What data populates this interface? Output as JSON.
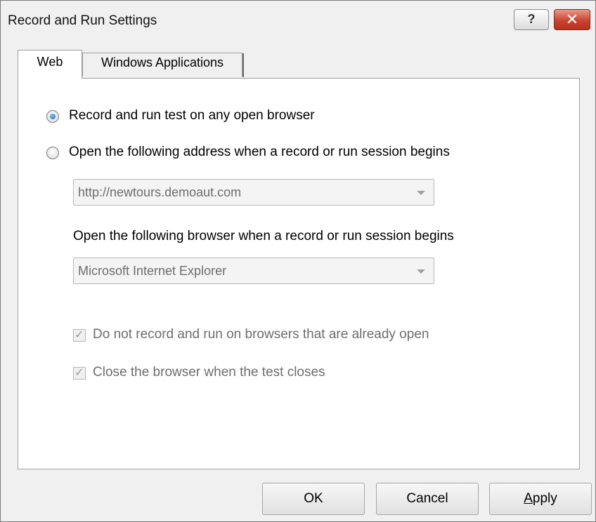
{
  "window": {
    "title": "Record and Run Settings",
    "help_label": "?",
    "close_label": "✕"
  },
  "tabs": [
    {
      "label": "Web",
      "selected": true
    },
    {
      "label": "Windows Applications",
      "selected": false
    }
  ],
  "web": {
    "radio_any_browser": {
      "label": "Record and run test on any open browser",
      "checked": true
    },
    "radio_open_address": {
      "label": "Open the following address when a record or run session begins",
      "checked": false
    },
    "address_combo": {
      "value": "http://newtours.demoaut.com",
      "enabled": false
    },
    "browser_section_label": "Open the following browser when a record or run session begins",
    "browser_combo": {
      "value": "Microsoft Internet Explorer",
      "enabled": false
    },
    "check_no_open_browsers": {
      "label": "Do not record and run on browsers that are already open",
      "checked": true,
      "enabled": false
    },
    "check_close_browser": {
      "label": "Close the browser when the test closes",
      "checked": true,
      "enabled": false
    }
  },
  "buttons": {
    "ok": "OK",
    "cancel": "Cancel",
    "apply_prefix": "",
    "apply_underlined": "A",
    "apply_rest": "pply"
  }
}
